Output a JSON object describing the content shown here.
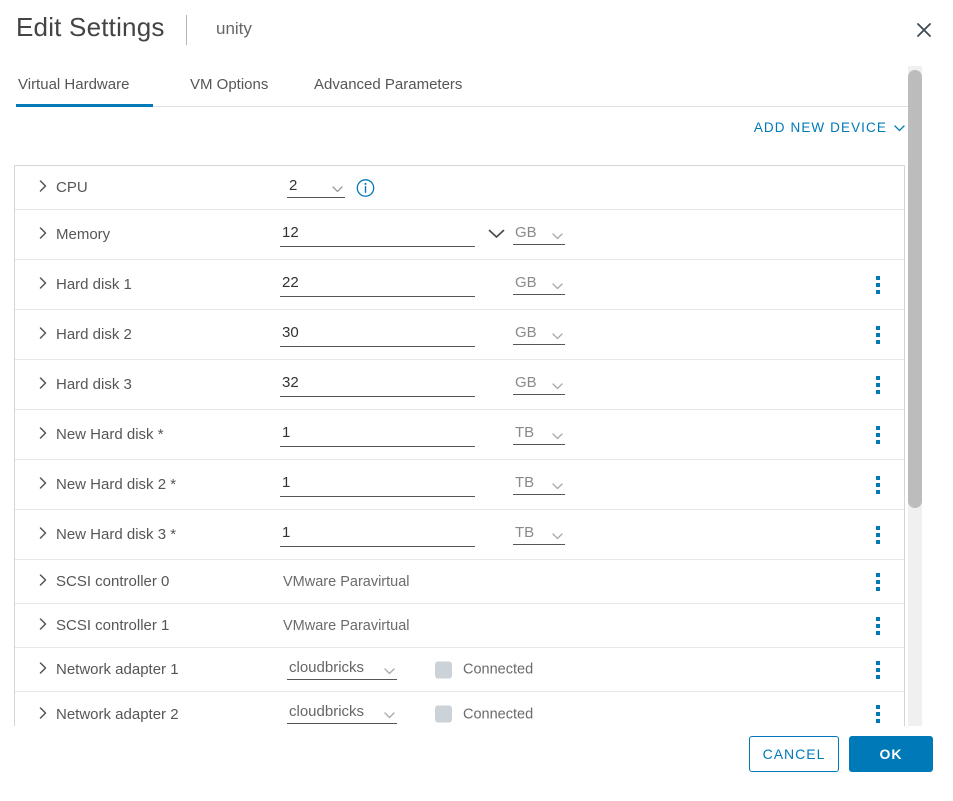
{
  "header": {
    "title": "Edit Settings",
    "subtitle": "unity",
    "close_icon": "close-icon"
  },
  "tabs": [
    {
      "label": "Virtual Hardware",
      "active": true
    },
    {
      "label": "VM Options",
      "active": false
    },
    {
      "label": "Advanced Parameters",
      "active": false
    }
  ],
  "toolbar": {
    "add_new_device_label": "ADD NEW DEVICE",
    "add_new_device_icon": "chevron-down-icon"
  },
  "colors": {
    "accent": "#0079b8",
    "label_text": "#565656",
    "muted_text": "#6b6b6b",
    "row_border": "#e3e9ec",
    "panel_border": "#cfd7dd",
    "checkbox_fill": "#cbd2d8",
    "scroll_thumb": "#bcbcbc",
    "scroll_track": "#f0f0f0"
  },
  "devices": [
    {
      "label": "CPU",
      "type": "cpu",
      "value": "2",
      "has_info_icon": true,
      "has_kebab": false
    },
    {
      "label": "Memory",
      "type": "memory",
      "value": "12",
      "unit": "GB",
      "has_combo_chevron": true,
      "has_kebab": false
    },
    {
      "label": "Hard disk 1",
      "type": "disk",
      "value": "22",
      "unit": "GB",
      "has_kebab": true
    },
    {
      "label": "Hard disk 2",
      "type": "disk",
      "value": "30",
      "unit": "GB",
      "has_kebab": true
    },
    {
      "label": "Hard disk 3",
      "type": "disk",
      "value": "32",
      "unit": "GB",
      "has_kebab": true
    },
    {
      "label": "New Hard disk *",
      "type": "disk",
      "value": "1",
      "unit": "TB",
      "has_kebab": true
    },
    {
      "label": "New Hard disk 2 *",
      "type": "disk",
      "value": "1",
      "unit": "TB",
      "has_kebab": true
    },
    {
      "label": "New Hard disk 3 *",
      "type": "disk",
      "value": "1",
      "unit": "TB",
      "has_kebab": true
    },
    {
      "label": "SCSI controller 0",
      "type": "controller",
      "static_value": "VMware Paravirtual",
      "has_kebab": true
    },
    {
      "label": "SCSI controller 1",
      "type": "controller",
      "static_value": "VMware Paravirtual",
      "has_kebab": true
    },
    {
      "label": "Network adapter 1",
      "type": "network",
      "network": "cloudbricks",
      "connected_label": "Connected",
      "connected_checked": false,
      "has_kebab": true
    },
    {
      "label": "Network adapter 2",
      "type": "network",
      "network": "cloudbricks",
      "connected_label": "Connected",
      "connected_checked": false,
      "has_kebab": true
    }
  ],
  "footer": {
    "cancel_label": "CANCEL",
    "ok_label": "OK"
  }
}
